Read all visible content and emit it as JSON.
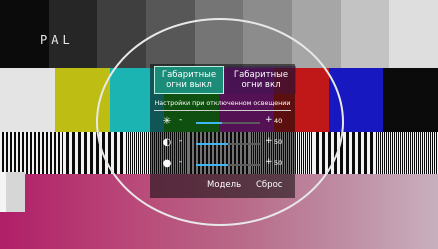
{
  "colors": {
    "toggle_active": "#1a8c78",
    "slider_fill": "#3fb7f2"
  },
  "test_pattern": {
    "label": "PAL",
    "row1": [
      "#0b0b0b",
      "#262626",
      "#3f3f3f",
      "#575757",
      "#757575",
      "#8c8c8c",
      "#a6a6a6",
      "#c3c3c3",
      "#dedede"
    ],
    "row2": [
      "#e4e4e4",
      "#bdbd14",
      "#1cb3b3",
      "#18a518",
      "#b01cb0",
      "#c01818",
      "#1818c0",
      "#0b0b0b"
    ]
  },
  "panel": {
    "toggle_off_label": "Габаритные огни выкл",
    "toggle_on_label": "Габаритные огни вкл",
    "settings_title": "Настройки при отключенном освещении",
    "sliders": [
      {
        "icon": "brightness-icon",
        "glyph": "✳",
        "minus": "-",
        "plus": "+",
        "value": "40",
        "level": 0.4
      },
      {
        "icon": "contrast-icon",
        "glyph": "◐",
        "minus": "-",
        "plus": "+",
        "value": "50",
        "level": 0.5
      },
      {
        "icon": "color-palette-icon",
        "glyph": "●",
        "minus": "-",
        "plus": "+",
        "value": "50",
        "level": 0.5
      }
    ],
    "model_label": "Модель",
    "reset_label": "Сброс"
  }
}
